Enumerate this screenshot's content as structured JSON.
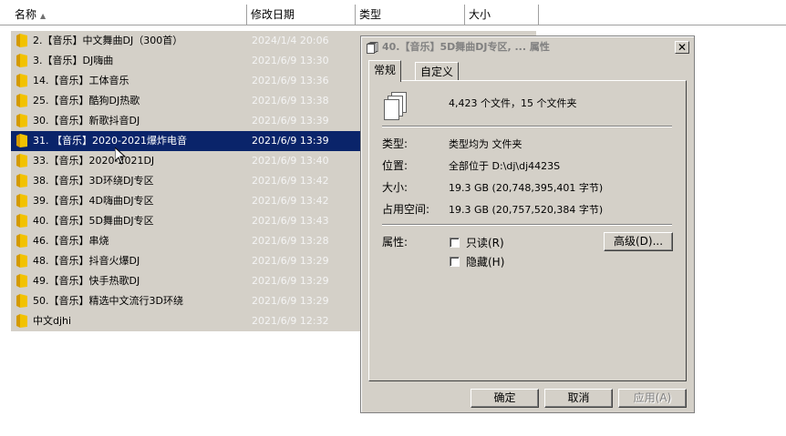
{
  "columns": {
    "name": "名称",
    "modified": "修改日期",
    "type": "类型",
    "size": "大小"
  },
  "files": [
    {
      "name": "2.【音乐】中文舞曲DJ（300首）",
      "date": "2024/1/4 20:06"
    },
    {
      "name": "3.【音乐】DJ嗨曲",
      "date": "2021/6/9 13:30"
    },
    {
      "name": "14.【音乐】工体音乐",
      "date": "2021/6/9 13:36"
    },
    {
      "name": "25.【音乐】酷狗DJ热歌",
      "date": "2021/6/9 13:38"
    },
    {
      "name": "30.【音乐】新歌抖音DJ",
      "date": "2021/6/9 13:39"
    },
    {
      "name": "31. 【音乐】2020-2021爆炸电音",
      "date": "2021/6/9 13:39"
    },
    {
      "name": "33.【音乐】2020-2021DJ",
      "date": "2021/6/9 13:40"
    },
    {
      "name": "38.【音乐】3D环绕DJ专区",
      "date": "2021/6/9 13:42"
    },
    {
      "name": "39.【音乐】4D嗨曲DJ专区",
      "date": "2021/6/9 13:42"
    },
    {
      "name": "40.【音乐】5D舞曲DJ专区",
      "date": "2021/6/9 13:43"
    },
    {
      "name": "46.【音乐】串烧",
      "date": "2021/6/9 13:28"
    },
    {
      "name": "48.【音乐】抖音火爆DJ",
      "date": "2021/6/9 13:29"
    },
    {
      "name": "49.【音乐】快手热歌DJ",
      "date": "2021/6/9 13:29"
    },
    {
      "name": "50.【音乐】精选中文流行3D环绕",
      "date": "2021/6/9 13:29"
    },
    {
      "name": "中文djhi",
      "date": "2021/6/9 12:32"
    }
  ],
  "selected_index": 5,
  "dialog": {
    "title": "40.【音乐】5D舞曲DJ专区, ... 属性",
    "tabs": [
      "常规",
      "自定义"
    ],
    "summary": "4,423 个文件，15 个文件夹",
    "props": [
      {
        "label": "类型:",
        "value": "类型均为 文件夹"
      },
      {
        "label": "位置:",
        "value": "全部位于 D:\\dj\\dj4423S"
      },
      {
        "label": "大小:",
        "value": "19.3 GB (20,748,395,401 字节)"
      },
      {
        "label": "占用空间:",
        "value": "19.3 GB (20,757,520,384 字节)"
      }
    ],
    "attributes_label": "属性:",
    "readonly_label": "只读(R)",
    "hidden_label": "隐藏(H)",
    "advanced_button": "高级(D)...",
    "ok_button": "确定",
    "cancel_button": "取消",
    "apply_button": "应用(A)"
  },
  "colors": {
    "selection": "#0a246a",
    "dialog_bg": "#d4d0c8",
    "folder": "#f2c200"
  }
}
